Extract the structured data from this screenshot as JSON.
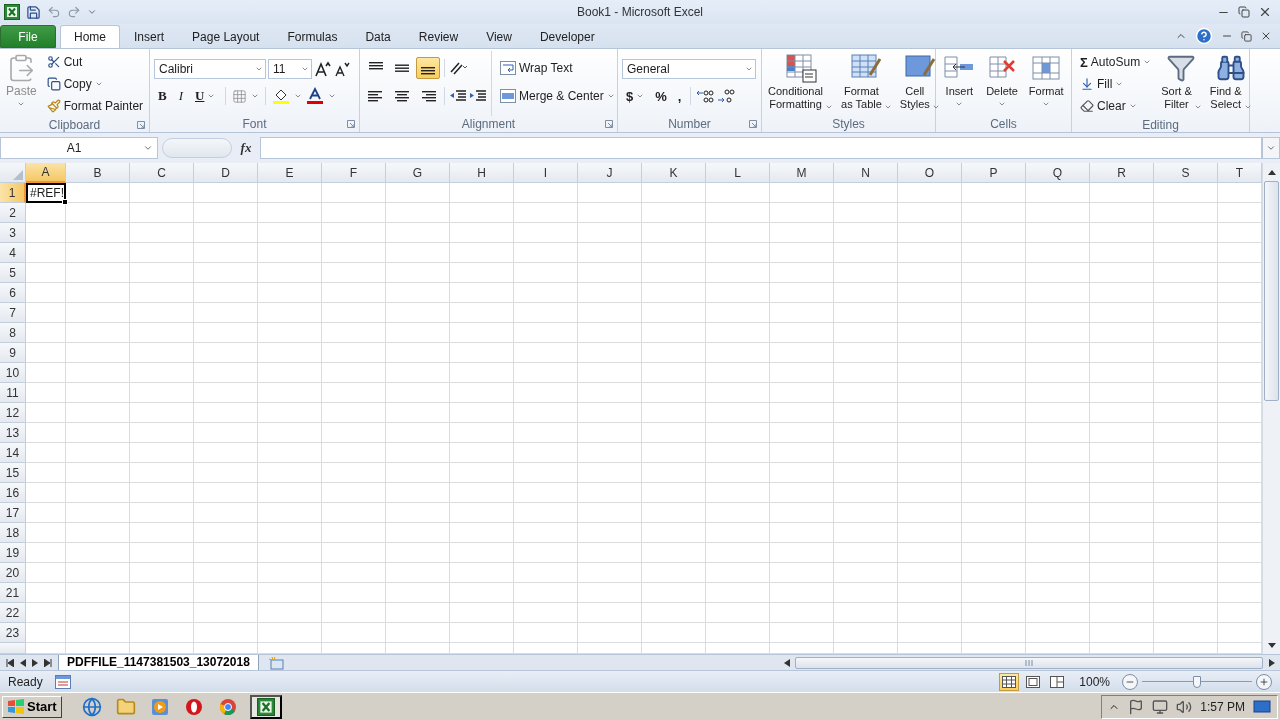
{
  "window": {
    "title": "Book1 - Microsoft Excel"
  },
  "tabs": [
    {
      "label": "File",
      "kind": "file",
      "selected": false
    },
    {
      "label": "Home",
      "kind": "tab",
      "selected": true
    },
    {
      "label": "Insert",
      "kind": "tab",
      "selected": false
    },
    {
      "label": "Page Layout",
      "kind": "tab",
      "selected": false
    },
    {
      "label": "Formulas",
      "kind": "tab",
      "selected": false
    },
    {
      "label": "Data",
      "kind": "tab",
      "selected": false
    },
    {
      "label": "Review",
      "kind": "tab",
      "selected": false
    },
    {
      "label": "View",
      "kind": "tab",
      "selected": false
    },
    {
      "label": "Developer",
      "kind": "tab",
      "selected": false
    }
  ],
  "ribbon": {
    "clipboard": {
      "label": "Clipboard",
      "paste": {
        "label": "Paste",
        "disabled": true
      },
      "cut": "Cut",
      "copy": "Copy",
      "format_painter": "Format Painter"
    },
    "font": {
      "label": "Font",
      "font_name": "Calibri",
      "font_size": "11",
      "bold": "B",
      "italic": "I",
      "underline": "U"
    },
    "alignment": {
      "label": "Alignment",
      "vertical_align": [
        {
          "selected": false
        },
        {
          "selected": false
        },
        {
          "selected": true
        }
      ],
      "wrap_text": "Wrap Text",
      "merge_center": "Merge & Center"
    },
    "number": {
      "label": "Number",
      "format": "General",
      "currency": "$",
      "percent": "%",
      "comma": ","
    },
    "styles": {
      "label": "Styles",
      "buttons": [
        {
          "label": "Conditional\nFormatting",
          "kind": "conditional"
        },
        {
          "label": "Format\nas Table",
          "kind": "table"
        },
        {
          "label": "Cell\nStyles",
          "kind": "cell-styles"
        }
      ]
    },
    "cells": {
      "label": "Cells",
      "buttons": [
        {
          "label": "Insert",
          "kind": "insert"
        },
        {
          "label": "Delete",
          "kind": "delete"
        },
        {
          "label": "Format",
          "kind": "format"
        }
      ]
    },
    "editing": {
      "label": "Editing",
      "autosum": {
        "symbol": "Σ",
        "label": "AutoSum"
      },
      "fill": "Fill",
      "clear": "Clear",
      "buttons": [
        {
          "label": "Sort &\nFilter",
          "kind": "sort"
        },
        {
          "label": "Find &\nSelect",
          "kind": "find"
        }
      ]
    }
  },
  "formula_bar": {
    "name_box": "A1",
    "function_button": "fx"
  },
  "sheet": {
    "columns": [
      {
        "label": "A",
        "selected": true
      },
      {
        "label": "B",
        "selected": false
      },
      {
        "label": "C",
        "selected": false
      },
      {
        "label": "D",
        "selected": false
      },
      {
        "label": "E",
        "selected": false
      },
      {
        "label": "F",
        "selected": false
      },
      {
        "label": "G",
        "selected": false
      },
      {
        "label": "H",
        "selected": false
      },
      {
        "label": "I",
        "selected": false
      },
      {
        "label": "J",
        "selected": false
      },
      {
        "label": "K",
        "selected": false
      },
      {
        "label": "L",
        "selected": false
      },
      {
        "label": "M",
        "selected": false
      },
      {
        "label": "N",
        "selected": false
      },
      {
        "label": "O",
        "selected": false
      },
      {
        "label": "P",
        "selected": false
      },
      {
        "label": "Q",
        "selected": false
      },
      {
        "label": "R",
        "selected": false
      },
      {
        "label": "S",
        "selected": false
      },
      {
        "label": "T",
        "selected": false
      }
    ],
    "rows": [
      {
        "label": "1",
        "selected": true,
        "cells": [
          {
            "value": "#REF!",
            "selected": true
          }
        ]
      },
      {
        "label": "2",
        "selected": false
      },
      {
        "label": "3",
        "selected": false
      },
      {
        "label": "4",
        "selected": false
      },
      {
        "label": "5",
        "selected": false
      },
      {
        "label": "6",
        "selected": false
      },
      {
        "label": "7",
        "selected": false
      },
      {
        "label": "8",
        "selected": false
      },
      {
        "label": "9",
        "selected": false
      },
      {
        "label": "10",
        "selected": false
      },
      {
        "label": "11",
        "selected": false
      },
      {
        "label": "12",
        "selected": false
      },
      {
        "label": "13",
        "selected": false
      },
      {
        "label": "14",
        "selected": false
      },
      {
        "label": "15",
        "selected": false
      },
      {
        "label": "16",
        "selected": false
      },
      {
        "label": "17",
        "selected": false
      },
      {
        "label": "18",
        "selected": false
      },
      {
        "label": "19",
        "selected": false
      },
      {
        "label": "20",
        "selected": false
      },
      {
        "label": "21",
        "selected": false
      },
      {
        "label": "22",
        "selected": false
      },
      {
        "label": "23",
        "selected": false
      }
    ]
  },
  "sheet_tabs": [
    {
      "label": "PDFFILE_1147381503_13072018",
      "selected": true
    }
  ],
  "status_bar": {
    "status": "Ready",
    "views": [
      {
        "selected": true
      },
      {
        "selected": false
      },
      {
        "selected": false
      }
    ],
    "zoom": "100%",
    "zoom_slider": {
      "level": 0.5
    }
  },
  "taskbar": {
    "start": "Start",
    "apps": [
      {
        "kind": "globe",
        "selected": false
      },
      {
        "kind": "folder",
        "selected": false
      },
      {
        "kind": "player",
        "selected": false
      },
      {
        "kind": "ring",
        "selected": false
      },
      {
        "kind": "wheel",
        "selected": false
      },
      {
        "kind": "sheet",
        "selected": true
      }
    ],
    "clock": "1:57 PM"
  }
}
